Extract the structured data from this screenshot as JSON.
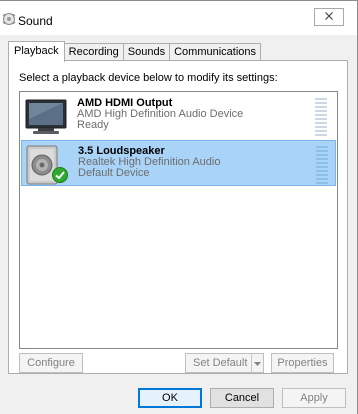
{
  "window": {
    "title": "Sound",
    "close_label": "×"
  },
  "tabs": [
    {
      "label": "Playback",
      "active": true
    },
    {
      "label": "Recording",
      "active": false
    },
    {
      "label": "Sounds",
      "active": false
    },
    {
      "label": "Communications",
      "active": false
    }
  ],
  "playback": {
    "instructions": "Select a playback device below to modify its settings:",
    "devices": [
      {
        "name": "AMD HDMI Output",
        "description": "AMD High Definition Audio Device",
        "status": "Ready",
        "icon": "monitor-icon",
        "selected": false
      },
      {
        "name": "3.5 Loudspeaker",
        "description": "Realtek High Definition Audio",
        "status": "Default Device",
        "icon": "speaker-icon",
        "selected": true
      }
    ],
    "configure_label": "Configure",
    "set_default_label": "Set Default",
    "properties_label": "Properties"
  },
  "footer": {
    "ok_label": "OK",
    "cancel_label": "Cancel",
    "apply_label": "Apply"
  },
  "colors": {
    "selection": "#a9d3f7",
    "accent": "#0078d7",
    "default_check": "#2faa2f"
  }
}
